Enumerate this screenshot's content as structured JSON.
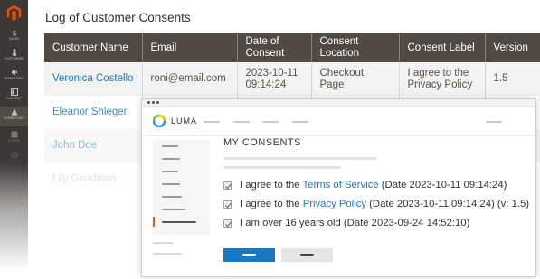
{
  "admin": {
    "nav": [
      {
        "label": "SALES",
        "icon": "dollar-icon"
      },
      {
        "label": "CUSTOMERS",
        "icon": "person-icon"
      },
      {
        "label": "MARKETING",
        "icon": "megaphone-icon"
      },
      {
        "label": "CONTENT",
        "icon": "layout-icon"
      },
      {
        "label": "PLUMROCKET",
        "icon": "plum-icon"
      },
      {
        "label": "STORES",
        "icon": "store-icon"
      },
      {
        "label": "SYSTEM",
        "icon": "gear-icon"
      }
    ]
  },
  "log": {
    "title": "Log of Customer Consents",
    "columns": [
      "Customer Name",
      "Email",
      "Date of Consent",
      "Consent Location",
      "Consent Label",
      "Version"
    ],
    "rows": [
      {
        "name": "Veronica Costello",
        "email": "roni@email.com",
        "date": "2023-10-11 09:14:24",
        "location": "Checkout Page",
        "label": "I agree to the Privacy Policy",
        "version": "1.5"
      },
      {
        "name": "Eleanor Shleger"
      },
      {
        "name": "John Doe"
      },
      {
        "name": "Lily Goodman"
      }
    ]
  },
  "storefront": {
    "brand": "LUMA",
    "heading": "MY CONSENTS",
    "consents": [
      {
        "prefix": "I agree to the ",
        "link": "Terms of Service",
        "suffix": " (Date 2023-10-11 09:14:24)"
      },
      {
        "prefix": "I agree to the ",
        "link": "Privacy Policy",
        "suffix": " (Date 2023-10-11 09:14:24) (v: 1.5)"
      },
      {
        "prefix": "I am over 16 years old (Date 2023-09-24 14:52:10)",
        "link": "",
        "suffix": ""
      }
    ]
  },
  "colors": {
    "sidebar": "#3d3834",
    "table_header": "#514943",
    "link": "#1979c3",
    "primary_button": "#1979c3",
    "active_nav_marker": "#e05a18"
  }
}
